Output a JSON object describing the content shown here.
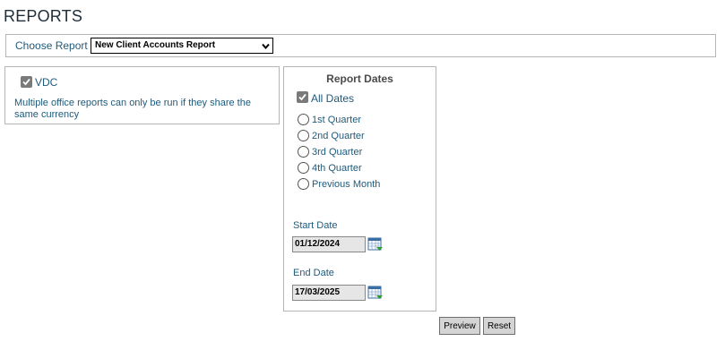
{
  "page": {
    "title": "REPORTS"
  },
  "choose_report": {
    "label": "Choose Report",
    "selected": "New Client Accounts Report"
  },
  "office": {
    "vdc_label": "VDC",
    "vdc_checked": true,
    "warning": "Multiple office reports can only be run if they share the same currency"
  },
  "report_dates": {
    "heading": "Report Dates",
    "all_dates_label": "All Dates",
    "all_dates_checked": true,
    "options": [
      {
        "label": "1st Quarter"
      },
      {
        "label": "2nd Quarter"
      },
      {
        "label": "3rd Quarter"
      },
      {
        "label": "4th Quarter"
      },
      {
        "label": "Previous Month"
      }
    ],
    "start_date_label": "Start Date",
    "start_date_value": "01/12/2024",
    "end_date_label": "End Date",
    "end_date_value": "17/03/2025"
  },
  "actions": {
    "preview_label": "Preview",
    "reset_label": "Reset"
  },
  "colors": {
    "label_text": "#1f5a7a",
    "button_bg": "#d4d4d4",
    "input_bg": "#e6e6e6"
  }
}
